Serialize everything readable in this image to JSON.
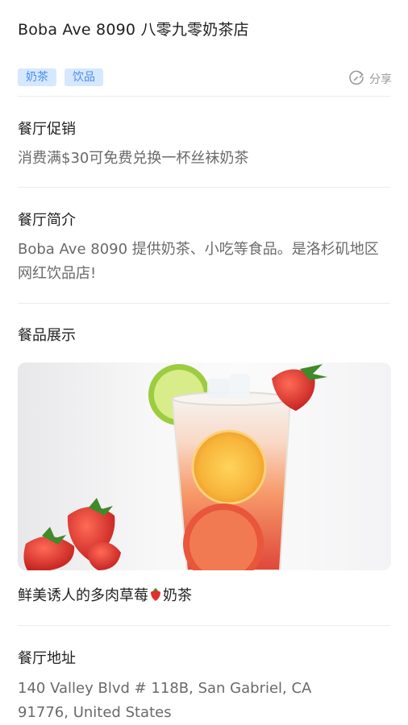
{
  "restaurant": {
    "title": "Boba Ave 8090 八零九零奶茶店",
    "tags": [
      "奶茶",
      "饮品"
    ],
    "share_label": "分享"
  },
  "sections": {
    "promo": {
      "heading": "餐厅促销",
      "text": "消费满$30可免费兑换一杯丝袜奶茶"
    },
    "intro": {
      "heading": "餐厅简介",
      "text": "Boba Ave 8090 提供奶茶、小吃等食品。是洛杉矶地区网红饮品店!"
    },
    "showcase": {
      "heading": "餐品展示",
      "caption_before": "鲜美诱人的多肉草莓",
      "caption_after": "奶茶"
    },
    "address": {
      "heading": "餐厅地址",
      "line1": "140 Valley Blvd # 118B, San Gabriel, CA",
      "line2": "91776, United States"
    }
  },
  "colors": {
    "tag_bg": "#d6e8ff",
    "tag_text": "#4b8df0",
    "divider": "#ececec"
  },
  "icons": {
    "share": "share-arrow-icon",
    "strawberry_emoji": "strawberry-icon"
  }
}
